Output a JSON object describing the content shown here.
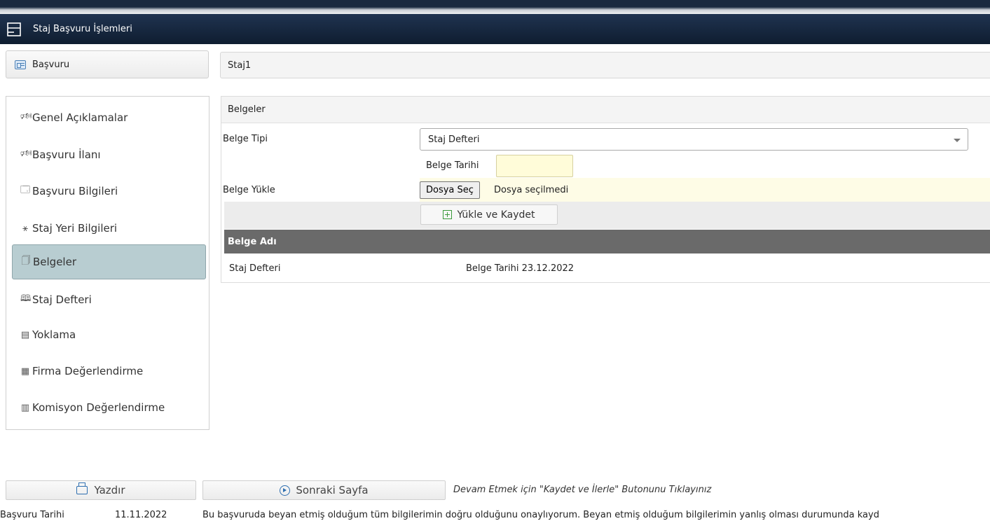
{
  "window": {
    "title": "Staj Başvuru İşlemleri"
  },
  "tab": {
    "label": "Başvuru"
  },
  "application": {
    "name": "Staj1"
  },
  "sidebar": {
    "items": [
      {
        "icon": "🕬",
        "label": "Genel Açıklamalar"
      },
      {
        "icon": "🕬",
        "label": "Başvuru İlanı"
      },
      {
        "icon": "🗔",
        "label": "Başvuru Bilgileri"
      },
      {
        "icon": "⚹",
        "label": "Staj Yeri Bilgileri"
      },
      {
        "icon": "🗍",
        "label": "Belgeler"
      },
      {
        "icon": "🕮",
        "label": "Staj Defteri"
      },
      {
        "icon": "▤",
        "label": "Yoklama"
      },
      {
        "icon": "▦",
        "label": "Firma Değerlendirme"
      },
      {
        "icon": "▥",
        "label": "Komisyon Değerlendirme"
      }
    ],
    "active_index": 4
  },
  "documents": {
    "header": "Belgeler",
    "type_label": "Belge Tipi",
    "type_value": "Staj Defteri",
    "date_label": "Belge Tarihi",
    "date_value": "",
    "upload_label": "Belge Yükle",
    "file_button": "Dosya Seç",
    "file_status": "Dosya seçilmedi",
    "save_button": "Yükle ve Kaydet",
    "table": {
      "header": "Belge Adı",
      "rows": [
        {
          "name": "Staj Defteri",
          "date": "Belge Tarihi 23.12.2022"
        }
      ]
    }
  },
  "actions": {
    "print": "Yazdır",
    "next": "Sonraki Sayfa",
    "hint": "Devam Etmek için \"Kaydet ve İlerle\" Butonunu Tıklayınız"
  },
  "footer": {
    "date_label": "Başvuru Tarihi",
    "date_value": "11.11.2022",
    "declaration": "Bu başvuruda beyan etmiş olduğum tüm bilgilerimin doğru olduğunu onaylıyorum. Beyan etmiş olduğum bilgilerimin yanlış olması durumunda kayd"
  },
  "colors": {
    "titlebar": "#0f1d30",
    "active_menu": "#b8cdd1",
    "table_header": "#6a6a6a",
    "date_field": "#fffcd9"
  }
}
